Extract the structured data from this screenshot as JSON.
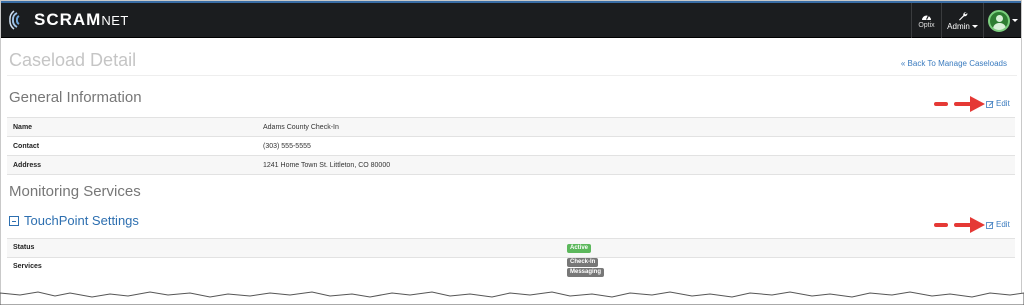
{
  "navbar": {
    "brand_main": "SCRAM",
    "brand_suffix": "NET",
    "optix_label": "Optix",
    "admin_label": "Admin",
    "icons": [
      "scram-logo-icon",
      "speedometer-icon",
      "wrench-icon",
      "user-avatar-icon",
      "caret-down-icon"
    ]
  },
  "page": {
    "title": "Caseload Detail",
    "back_link": "« Back To Manage Caseloads"
  },
  "general": {
    "heading": "General Information",
    "edit_label": "Edit",
    "rows": [
      {
        "label": "Name",
        "value": "Adams County Check-In"
      },
      {
        "label": "Contact",
        "value": "(303) 555-5555"
      },
      {
        "label": "Address",
        "value": "1241 Home Town St. Littleton, CO 80000"
      }
    ]
  },
  "monitoring": {
    "heading": "Monitoring Services",
    "touchpoint": {
      "heading": "TouchPoint Settings",
      "edit_label": "Edit",
      "status_label": "Status",
      "status_value": "Active",
      "services_label": "Services",
      "services": [
        "Check-In",
        "Messaging"
      ]
    }
  },
  "colors": {
    "navbar_bg": "#1b1d1f",
    "link_blue": "#3a7bbf",
    "active_green": "#5cb85c",
    "service_gray": "#777777",
    "annotation_red": "#e53935"
  }
}
